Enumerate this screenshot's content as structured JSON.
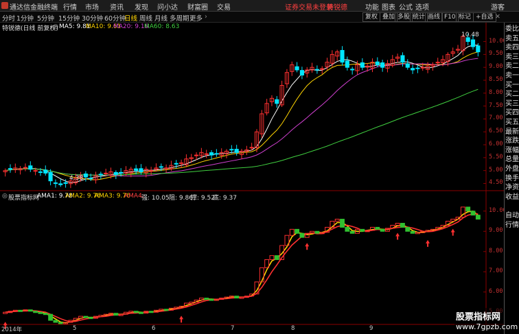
{
  "menubar": {
    "app_name": "通达信金融终端",
    "menus": [
      "行情",
      "市场",
      "资讯",
      "发现",
      "问小达",
      "财富圈",
      "交易"
    ],
    "alert": "证券交易未登录",
    "user": "特锐德",
    "right_items": [
      "功能",
      "图表",
      "公式",
      "选项"
    ],
    "guest": "游客"
  },
  "toolbar": {
    "timeframes": [
      "分时",
      "1分钟",
      "5分钟",
      "15分钟",
      "30分钟",
      "60分钟",
      "日线",
      "周线",
      "月线",
      "多周期",
      "更多"
    ],
    "active_timeframe": "日线",
    "buttons": [
      "复权",
      "叠加",
      "多股",
      "统计",
      "画线",
      "F10",
      "标记",
      "+自选"
    ]
  },
  "main_panel": {
    "title": "特锐德(日线 前复权)",
    "ma": [
      {
        "label": "MA5: 9.81",
        "color": "#ffffff"
      },
      {
        "label": "MA10: 9.61",
        "color": "#ffd400"
      },
      {
        "label": "MA20: 9.16",
        "color": "#d040d0"
      },
      {
        "label": "MA60: 8.63",
        "color": "#40d040"
      }
    ],
    "y_ticks": [
      "10.00",
      "9.50",
      "9.00",
      "8.50",
      "8.00",
      "7.50",
      "7.00",
      "6.50",
      "6.00",
      "5.50",
      "5.00",
      "4.50"
    ],
    "high_label": "10.48",
    "low_label": "4.38"
  },
  "sub_panel": {
    "title": "股票指标网",
    "ama": [
      {
        "label": "AMA1: 9.78",
        "color": "#ffffff"
      },
      {
        "label": "AMA2: 9.76",
        "color": "#ffd400"
      },
      {
        "label": "AMA3: 9.76",
        "color": "#ffd400"
      },
      {
        "label": "AMA4:",
        "color": "#ff4040"
      }
    ],
    "extras": [
      "强: 10.05",
      "阻: 9.86",
      "撑: 9.52",
      "底: 9.37"
    ],
    "y_ticks": [
      "10.00",
      "9.00",
      "8.00",
      "7.00",
      "6.00",
      "5.00"
    ]
  },
  "x_axis": [
    "2014年",
    "5",
    "6",
    "7",
    "8",
    "9"
  ],
  "side_panel": [
    "委比",
    "卖五",
    "卖四",
    "卖三",
    "卖二",
    "卖一",
    "买一",
    "买二",
    "买三",
    "买四",
    "买五",
    "最新",
    "涨跌",
    "涨幅",
    "总量",
    "外盘",
    "换手",
    "净资",
    "收益",
    "",
    "自动",
    "行情"
  ],
  "watermark": {
    "line1": "股票指标网",
    "line2": "www.7gpzb.com"
  },
  "colors": {
    "up": "#ff3030",
    "down": "#00e5ff",
    "bg": "#000000",
    "grid": "#8b0000"
  },
  "chart_data": [
    {
      "type": "candlestick",
      "title": "特锐德(日线 前复权)",
      "x_labels": [
        "2014年",
        "5",
        "6",
        "7",
        "8",
        "9"
      ],
      "ylim": [
        4.3,
        10.6
      ],
      "series": [
        {
          "name": "MA5",
          "last": 9.81
        },
        {
          "name": "MA10",
          "last": 9.61
        },
        {
          "name": "MA20",
          "last": 9.16
        },
        {
          "name": "MA60",
          "last": 8.63
        }
      ],
      "close": [
        5.0,
        5.05,
        5.1,
        5.08,
        5.12,
        5.05,
        5.0,
        4.95,
        4.9,
        4.6,
        4.5,
        4.45,
        4.5,
        4.6,
        4.7,
        4.8,
        4.75,
        4.7,
        4.8,
        4.85,
        4.9,
        4.95,
        4.85,
        4.9,
        5.0,
        5.05,
        5.0,
        4.95,
        5.05,
        5.0,
        5.1,
        5.15,
        5.1,
        5.2,
        5.25,
        5.3,
        5.45,
        5.5,
        5.6,
        5.7,
        5.65,
        5.6,
        5.65,
        5.7,
        5.75,
        5.8,
        5.7,
        5.75,
        5.8,
        5.9,
        6.5,
        7.2,
        7.6,
        7.8,
        7.6,
        8.3,
        8.8,
        9.1,
        8.9,
        8.7,
        8.9,
        9.0,
        8.9,
        8.95,
        9.2,
        9.5,
        9.6,
        9.2,
        9.0,
        8.9,
        9.1,
        9.0,
        9.05,
        9.2,
        9.1,
        9.0,
        9.15,
        9.3,
        9.4,
        9.2,
        9.0,
        8.9,
        8.95,
        9.0,
        9.05,
        9.1,
        9.2,
        9.3,
        9.5,
        9.6,
        9.7,
        10.2,
        10.0,
        9.8,
        9.6
      ]
    },
    {
      "type": "line",
      "title": "股票指标网",
      "ylim": [
        4.5,
        10.4
      ],
      "series": [
        {
          "name": "AMA1",
          "last": 9.78
        },
        {
          "name": "AMA2",
          "last": 9.76
        },
        {
          "name": "AMA3",
          "last": 9.76
        }
      ],
      "levels": {
        "强": 10.05,
        "阻": 9.86,
        "撑": 9.52,
        "底": 9.37
      }
    }
  ]
}
